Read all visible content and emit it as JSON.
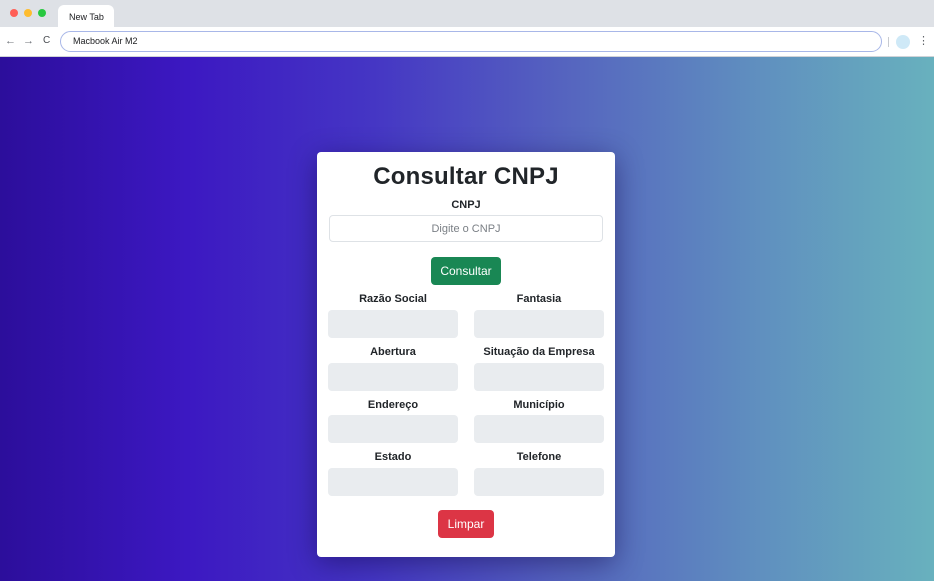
{
  "browser": {
    "tab_title": "New Tab",
    "address": "Macbook Air M2",
    "nav_back": "←",
    "nav_forward": "→",
    "nav_reload": "C",
    "menu": "⋮"
  },
  "form": {
    "title": "Consultar CNPJ",
    "cnpj_label": "CNPJ",
    "cnpj_placeholder": "Digite o CNPJ",
    "cnpj_value": "",
    "consult_button": "Consultar",
    "clear_button": "Limpar",
    "fields": [
      {
        "label": "Razão Social",
        "value": ""
      },
      {
        "label": "Fantasia",
        "value": ""
      },
      {
        "label": "Abertura",
        "value": ""
      },
      {
        "label": "Situação da Empresa",
        "value": ""
      },
      {
        "label": "Endereço",
        "value": ""
      },
      {
        "label": "Município",
        "value": ""
      },
      {
        "label": "Estado",
        "value": ""
      },
      {
        "label": "Telefone",
        "value": ""
      }
    ]
  },
  "colors": {
    "consult_button": "#198754",
    "clear_button": "#dc3545",
    "gradient_start": "#2c0e9b",
    "gradient_end": "#68b1be"
  }
}
